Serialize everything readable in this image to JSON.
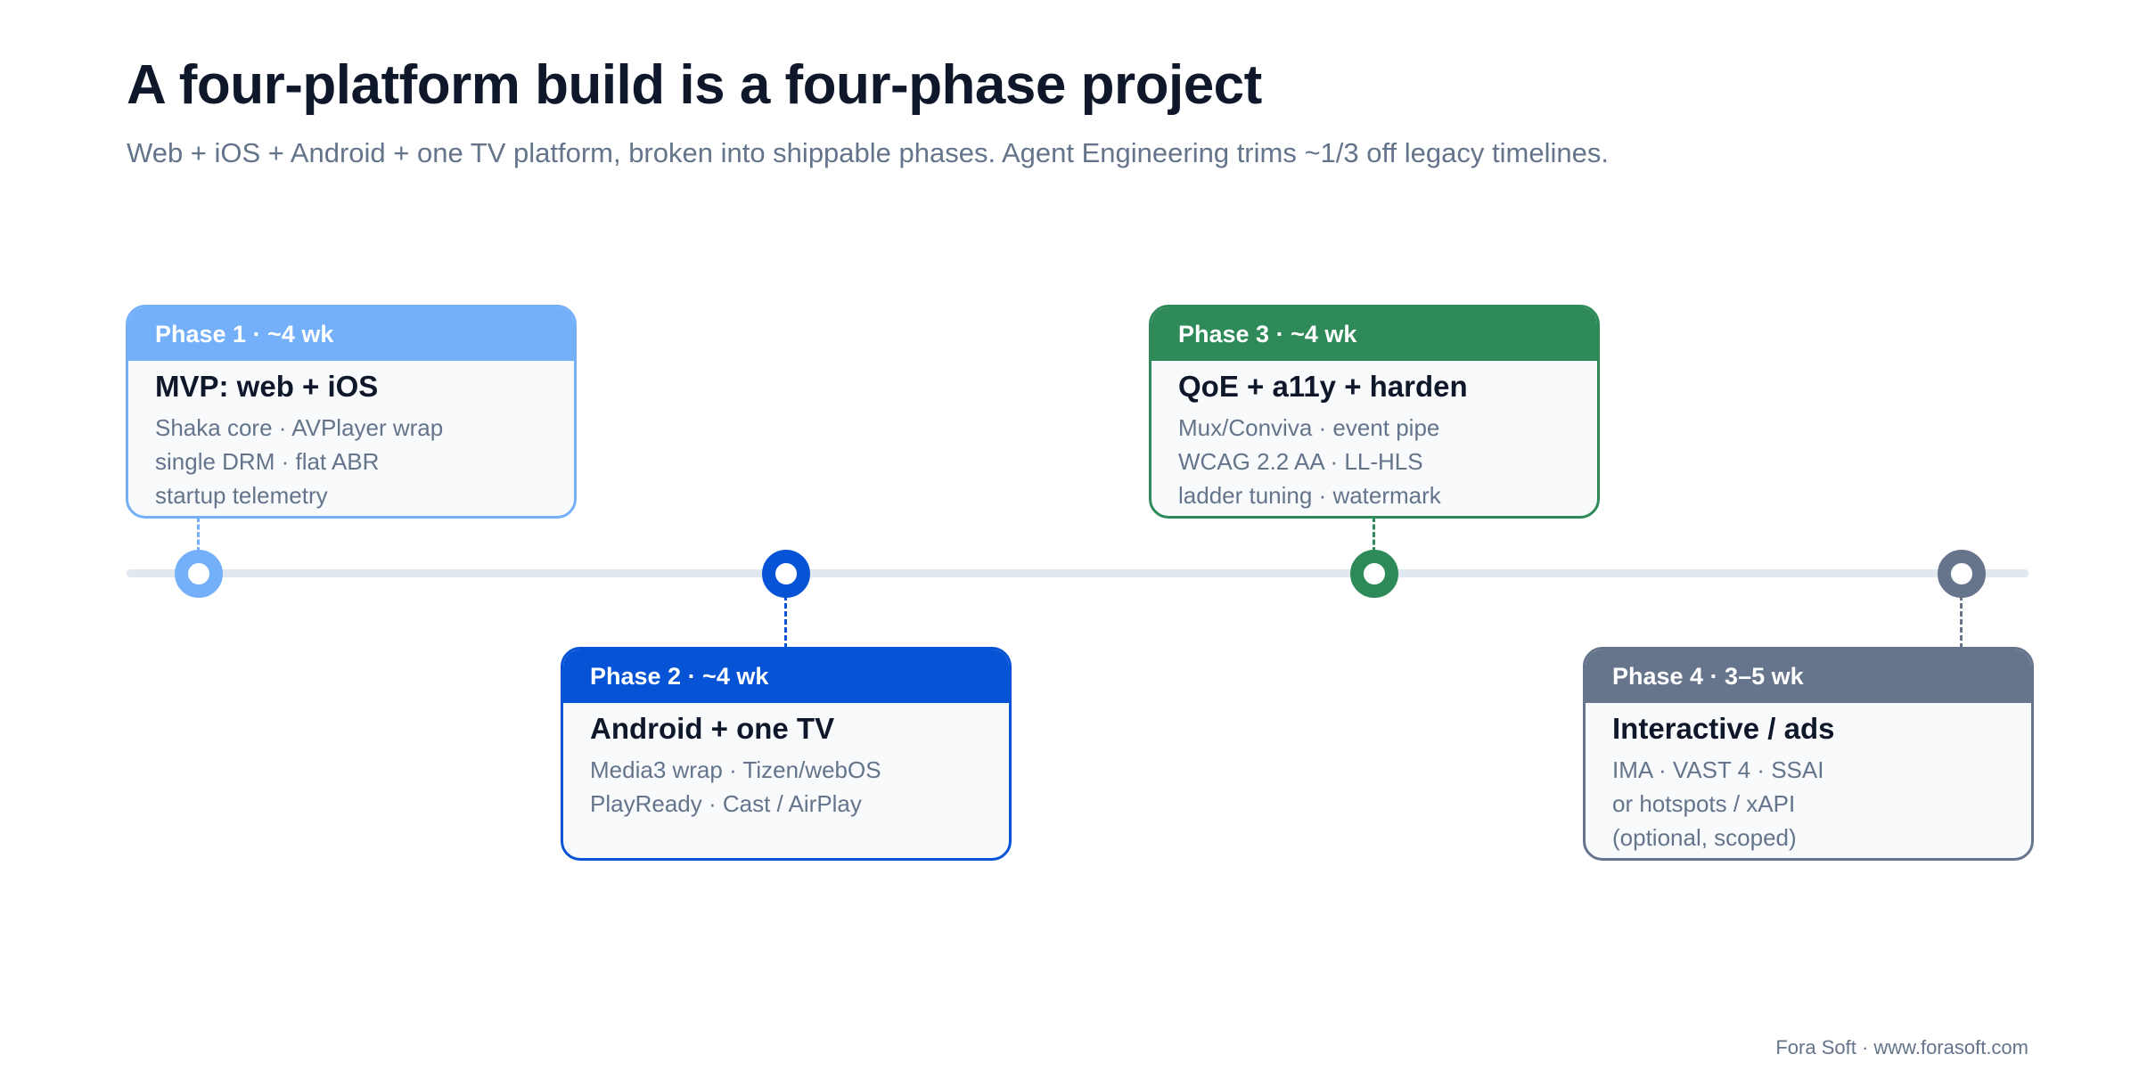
{
  "header": {
    "title": "A four-platform build is a four-phase project",
    "subtitle": "Web + iOS + Android + one TV platform, broken into shippable phases. Agent Engineering trims ~1/3 off legacy timelines."
  },
  "phases": [
    {
      "label": "Phase 1 · ~4 wk",
      "title": "MVP: web + iOS",
      "lines": [
        "Shaka core · AVPlayer wrap",
        "single DRM · flat ABR",
        "startup telemetry"
      ],
      "color": "#74b0fa"
    },
    {
      "label": "Phase 2 · ~4 wk",
      "title": "Android + one TV",
      "lines": [
        "Media3 wrap · Tizen/webOS",
        "PlayReady · Cast / AirPlay"
      ],
      "color": "#0653d6"
    },
    {
      "label": "Phase 3 · ~4 wk",
      "title": "QoE + a11y + harden",
      "lines": [
        "Mux/Conviva · event pipe",
        "WCAG 2.2 AA · LL-HLS",
        "ladder tuning · watermark"
      ],
      "color": "#2e8a58"
    },
    {
      "label": "Phase 4 · 3–5 wk",
      "title": "Interactive / ads",
      "lines": [
        "IMA · VAST 4 · SSAI",
        "or hotspots / xAPI",
        "(optional, scoped)"
      ],
      "color": "#66758c"
    }
  ],
  "footer": {
    "credit": "Fora Soft · www.forasoft.com"
  },
  "colors": {
    "track": "#e2e8f0",
    "title": "#0f172a",
    "muted": "#64748b",
    "card_bg": "#f8fafc"
  }
}
